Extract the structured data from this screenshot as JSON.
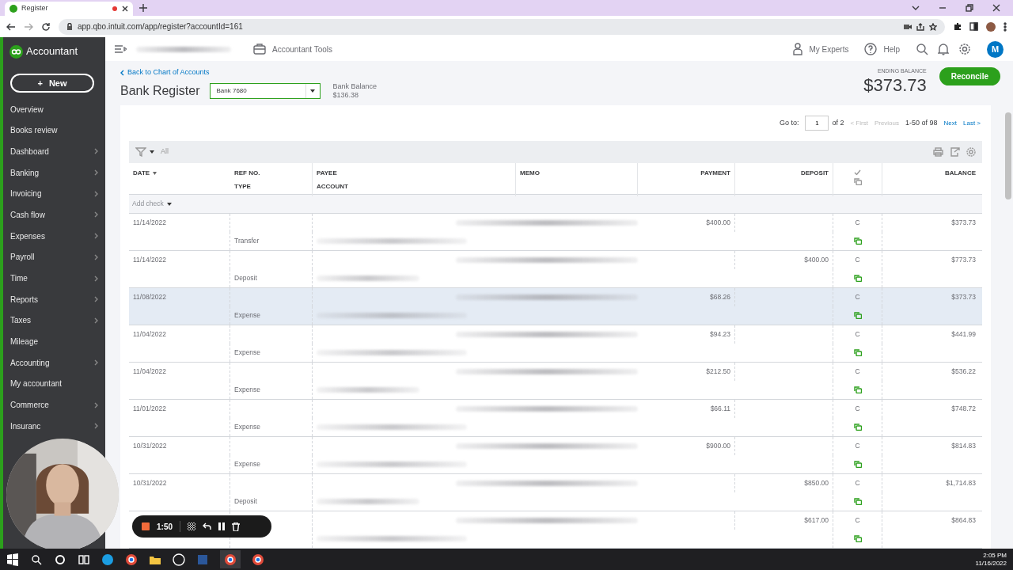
{
  "browser": {
    "tab_title": "Register",
    "url": "app.qbo.intuit.com/app/register?accountId=161"
  },
  "sidebar": {
    "logo": "Accountant",
    "new_button": "New",
    "new_icon": "+",
    "items": [
      {
        "label": "Overview",
        "has_submenu": false
      },
      {
        "label": "Books review",
        "has_submenu": false
      },
      {
        "label": "Dashboard",
        "has_submenu": true
      },
      {
        "label": "Banking",
        "has_submenu": true
      },
      {
        "label": "Invoicing",
        "has_submenu": true
      },
      {
        "label": "Cash flow",
        "has_submenu": true
      },
      {
        "label": "Expenses",
        "has_submenu": true
      },
      {
        "label": "Payroll",
        "has_submenu": true
      },
      {
        "label": "Time",
        "has_submenu": true
      },
      {
        "label": "Reports",
        "has_submenu": true
      },
      {
        "label": "Taxes",
        "has_submenu": true
      },
      {
        "label": "Mileage",
        "has_submenu": false
      },
      {
        "label": "Accounting",
        "has_submenu": true
      },
      {
        "label": "My accountant",
        "has_submenu": false
      },
      {
        "label": "Commerce",
        "has_submenu": true
      },
      {
        "label": "Insuranc",
        "has_submenu": true
      }
    ]
  },
  "header": {
    "accountant_tools": "Accountant Tools",
    "my_experts": "My Experts",
    "help": "Help",
    "avatar": "M"
  },
  "page": {
    "back_link": "Back to Chart of Accounts",
    "title": "Bank Register",
    "account": "Bank 7680",
    "bank_balance_label": "Bank Balance",
    "bank_balance": "$136.38",
    "ending_balance_label": "ENDING BALANCE",
    "ending_balance": "$373.73",
    "reconcile": "Reconcile"
  },
  "pagination": {
    "goto_label": "Go to:",
    "page": "1",
    "of_pages": "of 2",
    "first": "< First",
    "previous": "Previous",
    "range": "1-50 of 98",
    "next": "Next",
    "last": "Last >"
  },
  "filter": {
    "label": "All"
  },
  "table": {
    "columns": [
      [
        "DATE"
      ],
      [
        "REF NO.",
        "TYPE"
      ],
      [
        "PAYEE",
        "ACCOUNT"
      ],
      [
        "MEMO"
      ],
      [
        "PAYMENT"
      ],
      [
        "DEPOSIT"
      ],
      [],
      [
        "BALANCE"
      ]
    ],
    "add_check": "Add check",
    "rows": [
      {
        "date": "11/14/2022",
        "type": "Transfer",
        "payment": "$400.00",
        "deposit": "",
        "cleared": "C",
        "balance": "$373.73",
        "highlighted": false
      },
      {
        "date": "11/14/2022",
        "type": "Deposit",
        "payment": "",
        "deposit": "$400.00",
        "cleared": "C",
        "balance": "$773.73",
        "highlighted": false
      },
      {
        "date": "11/08/2022",
        "type": "Expense",
        "payment": "$68.26",
        "deposit": "",
        "cleared": "C",
        "balance": "$373.73",
        "highlighted": true
      },
      {
        "date": "11/04/2022",
        "type": "Expense",
        "payment": "$94.23",
        "deposit": "",
        "cleared": "C",
        "balance": "$441.99",
        "highlighted": false
      },
      {
        "date": "11/04/2022",
        "type": "Expense",
        "payment": "$212.50",
        "deposit": "",
        "cleared": "C",
        "balance": "$536.22",
        "highlighted": false
      },
      {
        "date": "11/01/2022",
        "type": "Expense",
        "payment": "$66.11",
        "deposit": "",
        "cleared": "C",
        "balance": "$748.72",
        "highlighted": false
      },
      {
        "date": "10/31/2022",
        "type": "Expense",
        "payment": "$900.00",
        "deposit": "",
        "cleared": "C",
        "balance": "$814.83",
        "highlighted": false
      },
      {
        "date": "10/31/2022",
        "type": "Deposit",
        "payment": "",
        "deposit": "$850.00",
        "cleared": "C",
        "balance": "$1,714.83",
        "highlighted": false
      },
      {
        "payment": "",
        "deposit": "$617.00",
        "cleared": "C",
        "balance": "$864.83",
        "highlighted": false
      }
    ]
  },
  "recorder": {
    "timer": "1:50"
  },
  "taskbar": {
    "time": "2:05 PM",
    "date": "11/16/2022"
  }
}
